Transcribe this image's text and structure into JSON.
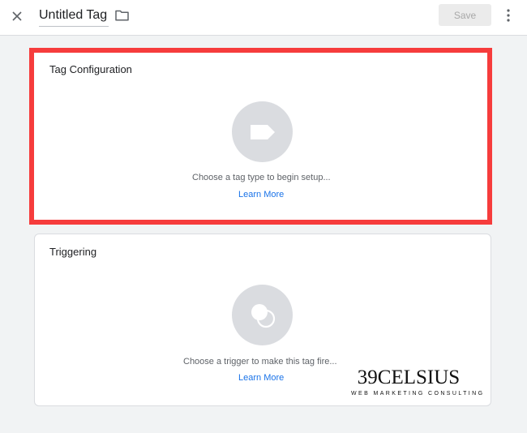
{
  "header": {
    "close_icon": "close-icon",
    "tag_name": "Untitled Tag",
    "folder_icon": "folder-icon",
    "save_label": "Save",
    "more_icon": "more-vert-icon"
  },
  "tag_configuration": {
    "title": "Tag Configuration",
    "icon": "tag-label-icon",
    "hint": "Choose a tag type to begin setup...",
    "link": "Learn More",
    "highlight_color": "#f63c3c"
  },
  "triggering": {
    "title": "Triggering",
    "icon": "trigger-circles-icon",
    "hint": "Choose a trigger to make this tag fire...",
    "link": "Learn More"
  },
  "watermark": {
    "name": "39CELSIUS",
    "tagline": "WEB MARKETING CONSULTING"
  },
  "colors": {
    "accent_link": "#1a73e8",
    "placeholder_gray": "#dadce0",
    "background": "#f1f3f4"
  }
}
